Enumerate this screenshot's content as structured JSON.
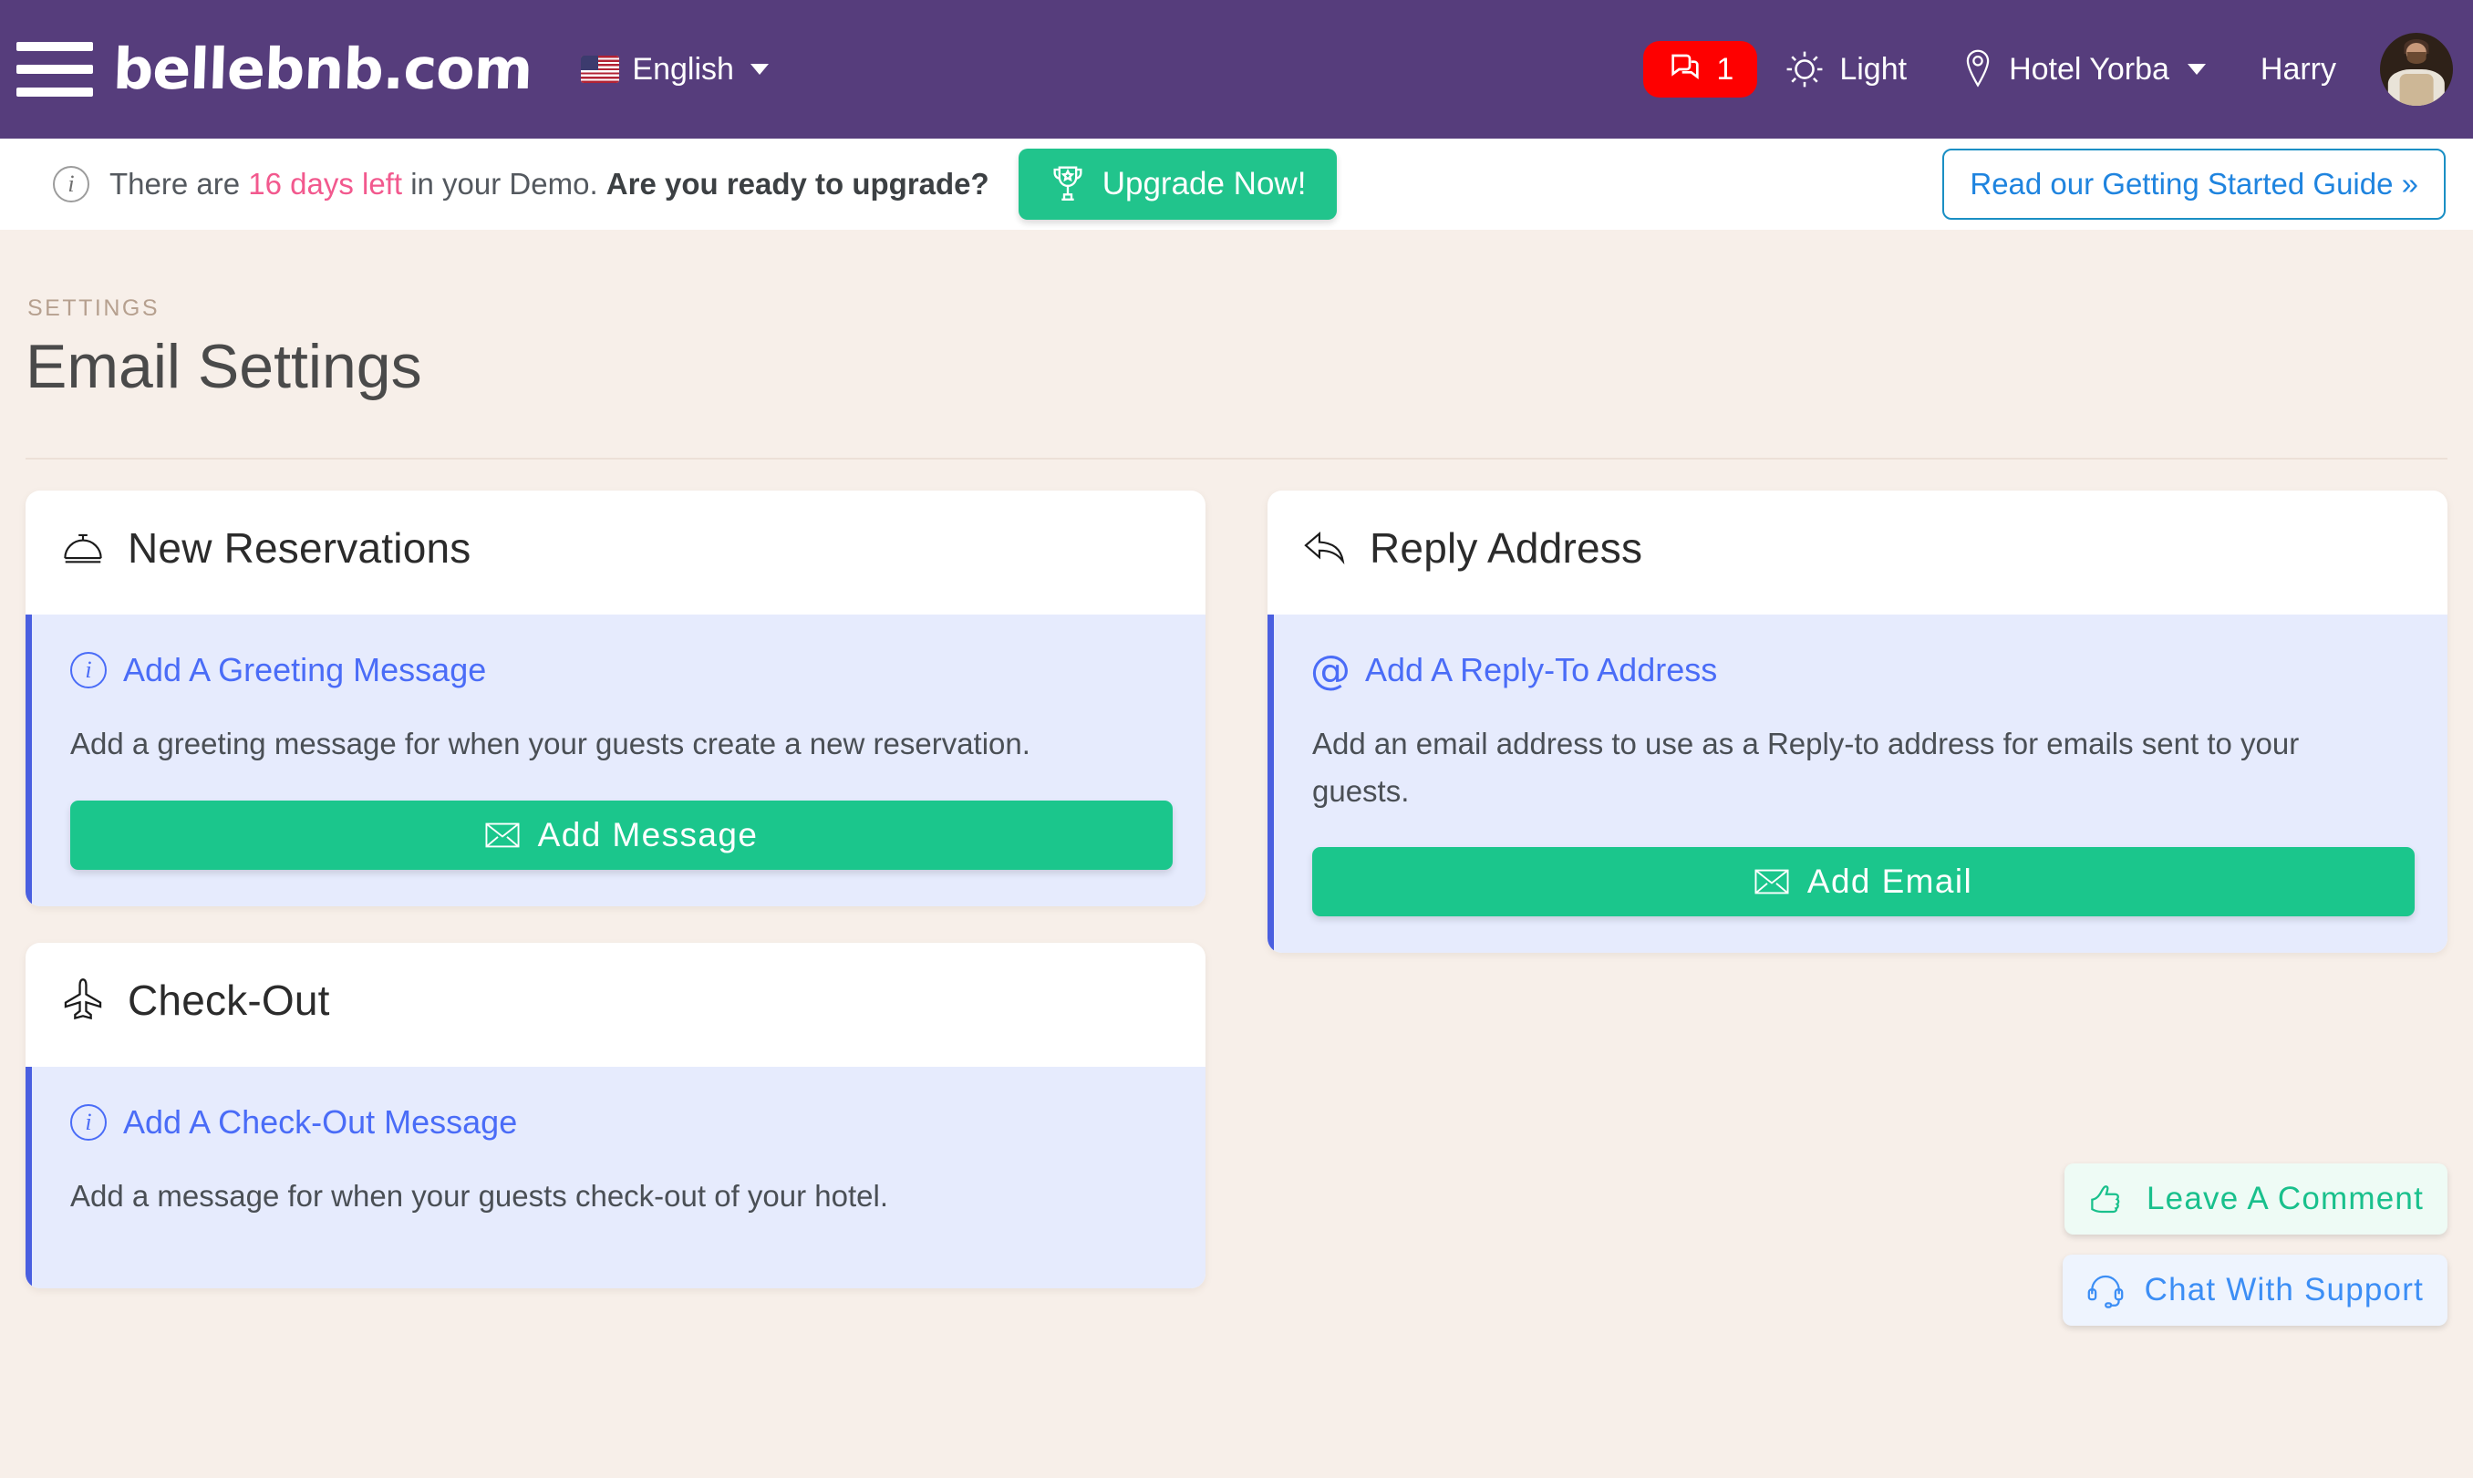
{
  "topbar": {
    "menu_icon": "hamburger-menu-icon",
    "brand": "bellebnb.com",
    "language": {
      "flag": "us-flag-icon",
      "label": "English",
      "caret": "chevron-down-icon"
    },
    "messages": {
      "icon": "chat-bubbles-icon",
      "count": "1",
      "badge_color": "#fe0000"
    },
    "theme": {
      "icon": "sun-icon",
      "label": "Light"
    },
    "property": {
      "icon": "map-pin-icon",
      "label": "Hotel Yorba",
      "caret": "chevron-down-icon"
    },
    "user": {
      "label": "Harry",
      "avatar": "user-avatar"
    },
    "bar_color": "#563d7c"
  },
  "notice": {
    "icon": "info-circle-icon",
    "text_pre": "There are ",
    "days_left": "16 days left",
    "text_mid": " in your Demo. ",
    "text_bold": "Are you ready to upgrade?",
    "upgrade_label": "Upgrade Now!",
    "upgrade_icon": "trophy-icon",
    "guide_label": "Read our Getting Started Guide »",
    "highlight_color": "#f2598e",
    "upgrade_color": "#21c48c",
    "guide_color": "#1f84df"
  },
  "page": {
    "eyebrow": "SETTINGS",
    "title": "Email Settings",
    "background_color": "#f7efe9"
  },
  "cards": {
    "new_reservations": {
      "icon": "service-bell-icon",
      "title": "New Reservations",
      "panel": {
        "icon": "info-circle-icon",
        "heading": "Add A Greeting Message",
        "description": "Add a greeting message for when your guests create a new reservation.",
        "button_label": "Add Message",
        "button_icon": "envelope-icon"
      }
    },
    "reply_address": {
      "icon": "reply-arrow-icon",
      "title": "Reply Address",
      "panel": {
        "icon": "at-sign-icon",
        "heading": "Add A Reply-To Address",
        "description": "Add an email address to use as a Reply-to address for emails sent to your guests.",
        "button_label": "Add Email",
        "button_icon": "envelope-icon"
      }
    },
    "check_out": {
      "icon": "airplane-icon",
      "title": "Check-Out",
      "panel": {
        "icon": "info-circle-icon",
        "heading": "Add A Check-Out Message",
        "description": "Add a message for when your guests check-out of your hotel."
      }
    }
  },
  "floaters": {
    "comment": {
      "icon": "thumbs-up-icon",
      "label": "Leave A Comment",
      "color": "#19c08c"
    },
    "chat": {
      "icon": "headset-icon",
      "label": "Chat With Support",
      "color": "#3c8ef5"
    }
  }
}
